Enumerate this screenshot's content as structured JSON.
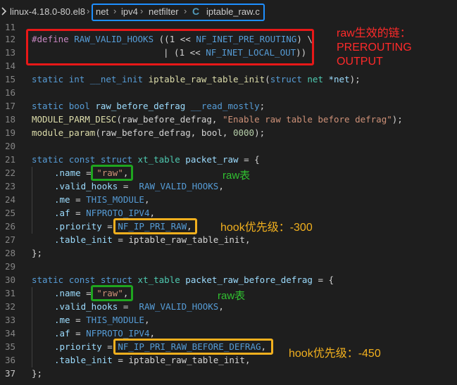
{
  "breadcrumb": {
    "project": "linux-4.18.0-80.el8",
    "path": [
      "net",
      "ipv4",
      "netfilter"
    ],
    "file_icon": "C",
    "file": "iptable_raw.c"
  },
  "lines": [
    {
      "n": "11"
    },
    {
      "n": "12"
    },
    {
      "n": "13"
    },
    {
      "n": "14"
    },
    {
      "n": "15"
    },
    {
      "n": "16"
    },
    {
      "n": "17"
    },
    {
      "n": "18"
    },
    {
      "n": "19"
    },
    {
      "n": "20"
    },
    {
      "n": "21"
    },
    {
      "n": "22"
    },
    {
      "n": "23"
    },
    {
      "n": "24"
    },
    {
      "n": "25"
    },
    {
      "n": "26"
    },
    {
      "n": "27"
    },
    {
      "n": "28"
    },
    {
      "n": "29"
    },
    {
      "n": "30"
    },
    {
      "n": "31"
    },
    {
      "n": "32"
    },
    {
      "n": "33"
    },
    {
      "n": "34"
    },
    {
      "n": "35"
    },
    {
      "n": "36"
    },
    {
      "n": "37"
    }
  ],
  "code": {
    "l12a": "#define",
    "l12b": "RAW_VALID_HOOKS",
    "l12c": "((1 << ",
    "l12d": "NF_INET_PRE_ROUTING",
    "l12e": ") \\",
    "l13a": "| (1 << ",
    "l13b": "NF_INET_LOCAL_OUT",
    "l13c": "))",
    "l15a": "static",
    "l15b": "int",
    "l15c": "__net_init",
    "l15d": "iptable_raw_table_init",
    "l15e": "(",
    "l15f": "struct",
    "l15g": "net",
    "l15h": "*net",
    "l15i": ");",
    "l17a": "static",
    "l17b": "bool",
    "l17c": "raw_before_defrag",
    "l17d": "__read_mostly",
    "l17e": ";",
    "l18a": "MODULE_PARM_DESC",
    "l18b": "(raw_before_defrag, ",
    "l18c": "\"Enable raw table before defrag\"",
    "l18d": ");",
    "l19a": "module_param",
    "l19b": "(raw_before_defrag, bool, ",
    "l19c": "0000",
    "l19d": ");",
    "l22a": "static",
    "l22b": "const",
    "l22c": "struct",
    "l22d": "xt_table",
    "l22e": "packet_raw",
    "l22f": " = {",
    "name_key": ".name",
    "name_val": "\"raw\"",
    "valid_key": ".valid_hooks",
    "valid_val": "RAW_VALID_HOOKS",
    "me_key": ".me",
    "me_val": "THIS_MODULE",
    "af_key": ".af",
    "af_val": "NFPROTO_IPV4",
    "prio_key": ".priority",
    "prio_val1": "NF_IP_PRI_RAW",
    "tinit_key": ".table_init",
    "tinit_val": "iptable_raw_table_init",
    "close": "};",
    "l30e": "packet_raw_before_defrag",
    "prio_val2": "NF_IP_PRI_RAW_BEFORE_DEFRAG"
  },
  "annotations": {
    "chains": "raw生效的链：\nPREROUTING\nOUTPUT",
    "raw_table_1": "raw表",
    "hook_priority_1": "hook优先级：-300",
    "raw_table_2": "raw表",
    "hook_priority_2": "hook优先级：-450"
  },
  "colors": {
    "red_box": "#e81818",
    "green_box": "#1fa51f",
    "orange_box": "#f2b01e",
    "blue_box": "#1e8fff"
  }
}
